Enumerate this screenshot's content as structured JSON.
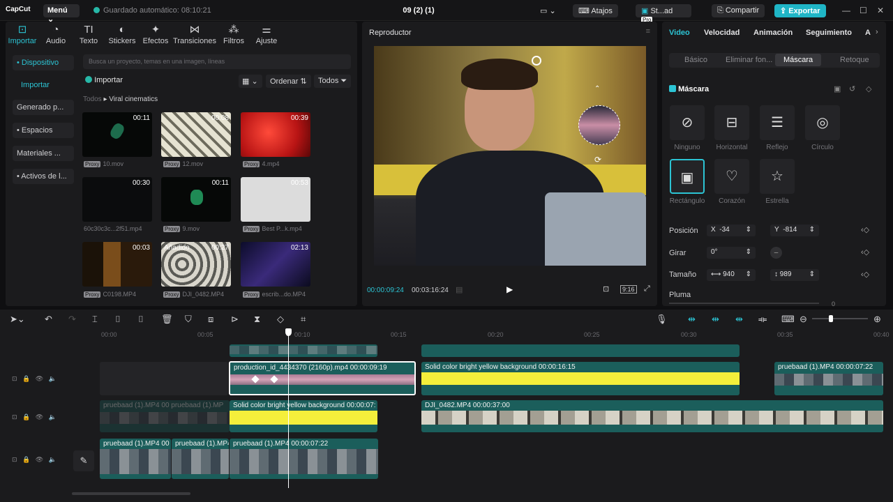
{
  "app": {
    "logo": "CapCut",
    "menu": "Menú",
    "autosave": "Guardado automático: 08:10:21",
    "project_title": "09 (2) (1)",
    "shortcuts": "Atajos",
    "studio": "St...ad",
    "pro_badge": "Pro",
    "share": "Compartir",
    "export": "Exportar"
  },
  "media_tabs": [
    {
      "label": "Importar",
      "icon": "import-icon"
    },
    {
      "label": "Audio",
      "icon": "audio-icon"
    },
    {
      "label": "Texto",
      "icon": "text-icon"
    },
    {
      "label": "Stickers",
      "icon": "sticker-icon"
    },
    {
      "label": "Efectos",
      "icon": "effects-icon"
    },
    {
      "label": "Transiciones",
      "icon": "transitions-icon"
    },
    {
      "label": "Filtros",
      "icon": "filters-icon"
    },
    {
      "label": "Ajuste",
      "icon": "adjust-icon"
    }
  ],
  "sidebar": [
    "• Dispositivo",
    "Importar",
    "Generado p...",
    "• Espacios",
    "Materiales ...",
    "• Activos de l..."
  ],
  "search_placeholder": "Busca un proyecto, temas en una imagen, líneas",
  "import_btn": "Importar",
  "order_btn": "Ordenar",
  "all_btn": "Todos",
  "breadcrumb": {
    "root": "Todos",
    "current": "Viral cinematics"
  },
  "media_items": [
    {
      "name": "10.mov",
      "dur": "00:11",
      "proxy": "Proxy"
    },
    {
      "name": "12.mov",
      "dur": "00:08",
      "proxy": "Proxy"
    },
    {
      "name": "4.mp4",
      "dur": "00:39",
      "proxy": "Proxy"
    },
    {
      "name": "60c30c3c...2f51.mp4",
      "dur": "00:30",
      "proxy": ""
    },
    {
      "name": "9.mov",
      "dur": "00:11",
      "proxy": "Proxy"
    },
    {
      "name": "Best P...k.mp4",
      "dur": "00:53",
      "proxy": "Proxy"
    },
    {
      "name": "C0198.MP4",
      "dur": "00:03",
      "proxy": "Proxy"
    },
    {
      "name": "DJI_0482.MP4",
      "dur": "00:27",
      "proxy": "Proxy",
      "badge": "Añadido"
    },
    {
      "name": "escrib...do.MP4",
      "dur": "02:13",
      "proxy": "Proxy"
    }
  ],
  "player": {
    "title": "Reproductor",
    "current": "00:00:09:24",
    "total": "00:03:16:24",
    "ratio": "9:16"
  },
  "props": {
    "tabs": [
      "Video",
      "Velocidad",
      "Animación",
      "Seguimiento",
      "A"
    ],
    "subtabs": [
      "Básico",
      "Eliminar fon...",
      "Máscara",
      "Retoque"
    ],
    "mask_title": "Máscara",
    "masks": [
      "Ninguno",
      "Horizontal",
      "Reflejo",
      "Círculo",
      "Rectángulo",
      "Corazón",
      "Estrella"
    ],
    "position_label": "Posición",
    "x_label": "X",
    "x_val": "-34",
    "y_label": "Y",
    "y_val": "-814",
    "rotate_label": "Girar",
    "rotate_val": "0°",
    "size_label": "Tamaño",
    "w_val": "940",
    "h_val": "989",
    "feather_label": "Pluma",
    "feather_val": "0"
  },
  "ruler": [
    "00:00",
    "00:05",
    "00:10",
    "00:15",
    "00:20",
    "00:25",
    "00:30",
    "00:35",
    "00:40"
  ],
  "clips": {
    "prod": "production_id_4434370 (2160p).mp4   00:00:09:19",
    "yellow1": "Solid color bright yellow background   00:00:16:15",
    "pruebaad1": "pruebaad (1).MP4   00:00:07:22",
    "ghost": "pruebaad (1).MP4  00  pruebaad (1).MP",
    "yellow2": "Solid color bright yellow background   00:00:07:",
    "dji": "DJI_0482.MP4   00:00:37:00",
    "pr_a": "pruebaad (1).MP4   00",
    "pr_b": "pruebaad (1).MP4",
    "pr_c": "pruebaad (1).MP4   00:00:07:22"
  }
}
